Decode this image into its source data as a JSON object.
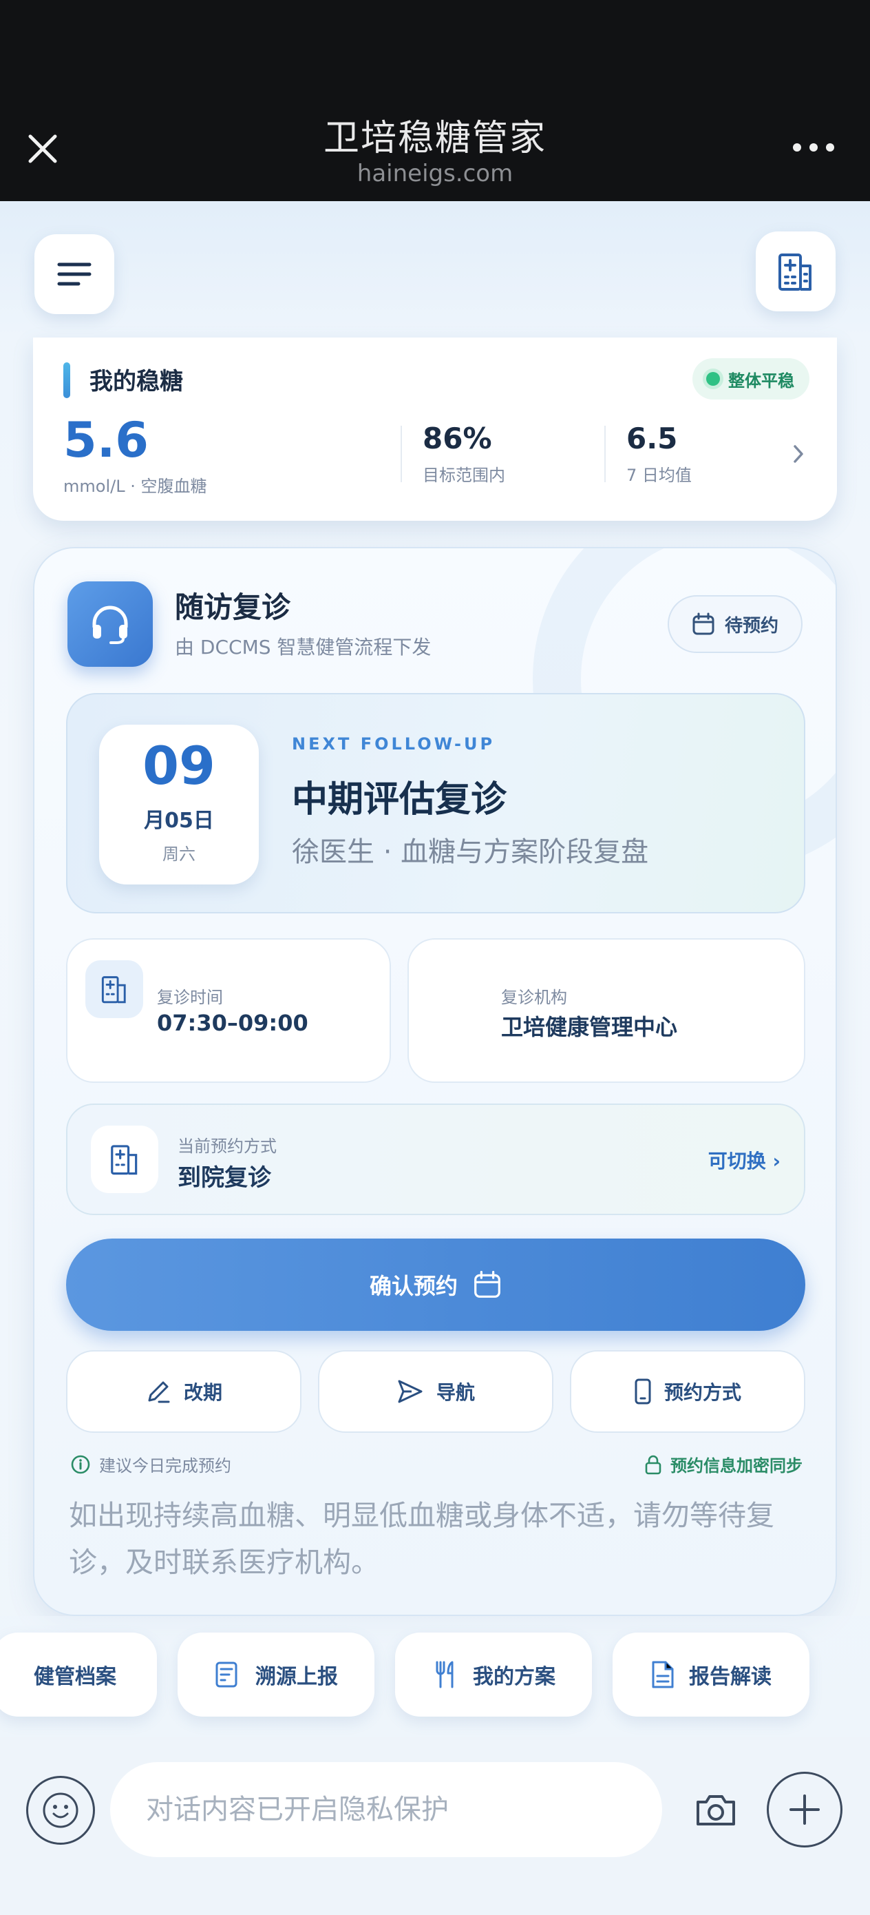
{
  "browser": {
    "title": "卫培稳糖管家",
    "url": "haineigs.com"
  },
  "summary": {
    "label": "我的稳糖",
    "status_badge": "整体平稳",
    "glucose_value": "5.6",
    "glucose_unit": "mmol/L · 空腹血糖",
    "in_range_value": "86%",
    "in_range_label": "目标范围内",
    "avg_value": "6.5",
    "avg_label": "7 日均值"
  },
  "followup": {
    "title": "随访复诊",
    "subtitle": "由 DCCMS 智慧健管流程下发",
    "status_button": "待预约",
    "date_day": "09",
    "date_month": "月05日",
    "date_weekday": "周六",
    "eyebrow": "NEXT FOLLOW-UP",
    "visit_title": "中期评估复诊",
    "visit_desc": "徐医生 · 血糖与方案阶段复盘",
    "time_label": "复诊时间",
    "time_value": "07:30–09:00",
    "org_label": "复诊机构",
    "org_value": "卫培健康管理中心",
    "method_label": "当前预约方式",
    "method_value": "到院复诊",
    "switch_label": "可切换 ›",
    "confirm_label": "确认预约",
    "actions": [
      "改期",
      "导航",
      "预约方式"
    ],
    "hint": "建议今日完成预约",
    "secure": "预约信息加密同步",
    "warning": "如出现持续高血糖、明显低血糖或身体不适，请勿等待复诊，及时联系医疗机构。"
  },
  "shortcuts": [
    "健管档案",
    "溯源上报",
    "我的方案",
    "报告解读"
  ],
  "input": {
    "placeholder": "对话内容已开启隐私保护"
  },
  "colors": {
    "primary": "#3f7fd1",
    "success": "#2fc184",
    "title_text": "#1b2c44"
  }
}
